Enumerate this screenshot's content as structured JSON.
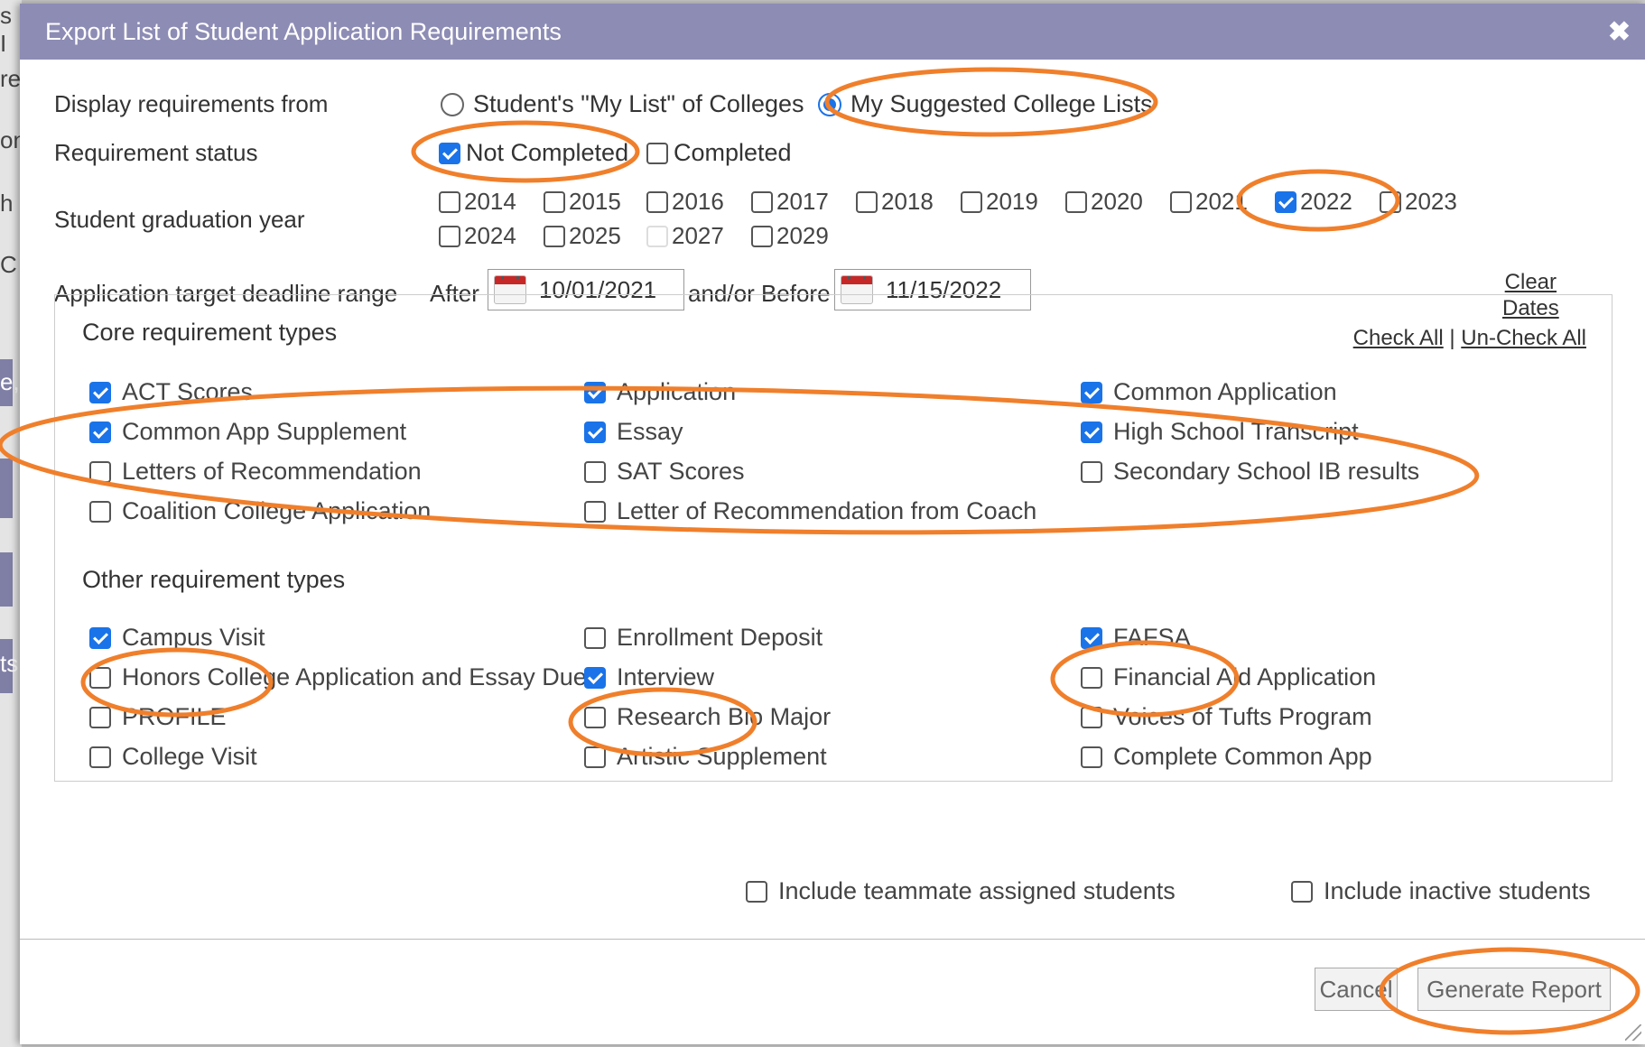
{
  "dialog": {
    "title": "Export List of Student Application Requirements"
  },
  "display_from": {
    "label": "Display requirements from",
    "options": [
      {
        "label": "Student's \"My List\" of Colleges",
        "selected": false
      },
      {
        "label": "My Suggested College Lists",
        "selected": true
      }
    ]
  },
  "req_status": {
    "label": "Requirement status",
    "options": [
      {
        "label": "Not Completed",
        "checked": true
      },
      {
        "label": "Completed",
        "checked": false
      }
    ]
  },
  "grad_year": {
    "label": "Student graduation year",
    "years": [
      {
        "label": "2014",
        "checked": false
      },
      {
        "label": "2015",
        "checked": false
      },
      {
        "label": "2016",
        "checked": false
      },
      {
        "label": "2017",
        "checked": false
      },
      {
        "label": "2018",
        "checked": false
      },
      {
        "label": "2019",
        "checked": false
      },
      {
        "label": "2020",
        "checked": false
      },
      {
        "label": "2021",
        "checked": false
      },
      {
        "label": "2022",
        "checked": true
      },
      {
        "label": "2023",
        "checked": false
      },
      {
        "label": "2024",
        "checked": false
      },
      {
        "label": "2025",
        "checked": false
      },
      {
        "label": "2027",
        "checked": false
      },
      {
        "label": "2029",
        "checked": false
      }
    ]
  },
  "deadline": {
    "label": "Application target deadline range",
    "after_label": "After",
    "after_value": "10/01/2021",
    "before_label": "and/or Before",
    "before_value": "11/15/2022",
    "clear_line1": "Clear",
    "clear_line2": "Dates"
  },
  "core": {
    "title": "Core requirement types",
    "check_all": "Check All",
    "separator": "|",
    "uncheck_all": "Un-Check All",
    "items": [
      {
        "label": "ACT Scores",
        "checked": true
      },
      {
        "label": "Application",
        "checked": true
      },
      {
        "label": "Common Application",
        "checked": true
      },
      {
        "label": "Common App Supplement",
        "checked": true
      },
      {
        "label": "Essay",
        "checked": true
      },
      {
        "label": "High School Transcript",
        "checked": true
      },
      {
        "label": "Letters of Recommendation",
        "checked": false
      },
      {
        "label": "SAT Scores",
        "checked": false
      },
      {
        "label": "Secondary School IB results",
        "checked": false
      },
      {
        "label": "Coalition College Application",
        "checked": false
      },
      {
        "label": "Letter of Recommendation from Coach",
        "checked": false
      }
    ]
  },
  "other": {
    "title": "Other requirement types",
    "items": [
      {
        "label": "Campus Visit",
        "checked": true
      },
      {
        "label": "Enrollment Deposit",
        "checked": false
      },
      {
        "label": "FAFSA",
        "checked": true
      },
      {
        "label": "Honors College Application and Essay Due",
        "checked": false
      },
      {
        "label": "Interview",
        "checked": true
      },
      {
        "label": "Financial Aid Application",
        "checked": false
      },
      {
        "label": "PROFILE",
        "checked": false
      },
      {
        "label": "Research Bio Major",
        "checked": false
      },
      {
        "label": "Voices of Tufts Program",
        "checked": false
      },
      {
        "label": "College Visit",
        "checked": false
      },
      {
        "label": "Artistic Supplement",
        "checked": false
      },
      {
        "label": "Complete Common App",
        "checked": false
      }
    ]
  },
  "extra": {
    "teammate": {
      "label": "Include teammate assigned students",
      "checked": false
    },
    "inactive": {
      "label": "Include inactive students",
      "checked": false
    }
  },
  "buttons": {
    "cancel": "Cancel",
    "generate": "Generate Report"
  },
  "background_fragments": [
    "s I",
    "re",
    "on",
    "h",
    "C",
    "e,",
    "ts"
  ],
  "colors": {
    "titlebar": "#8d8cb5",
    "accent": "#1a73e8",
    "annotation": "#f07f2b"
  }
}
